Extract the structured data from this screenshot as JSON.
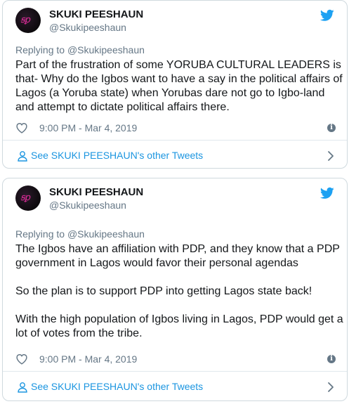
{
  "colors": {
    "twitter_blue": "#1da1f2",
    "link_blue": "#1b95e0",
    "secondary_text": "#657786",
    "avatar_accent": "#e02c9a"
  },
  "tweets": [
    {
      "author": {
        "display_name": "SKUKI PEESHAUN",
        "handle": "@Skukipeeshaun",
        "avatar_icon": "avatar-logo"
      },
      "replying_to": {
        "prefix": "Replying to",
        "handle": "@Skukipeeshaun"
      },
      "paragraphs": [
        "Part of the frustration of some YORUBA CULTURAL LEADERS is that- Why do the Igbos want to have a say in the political affairs of Lagos (a Yoruba state) when Yorubas dare not go to Igbo-land and attempt to dictate political affairs there."
      ],
      "timestamp": "9:00 PM - Mar 4, 2019",
      "other_tweets_label": "See SKUKI PEESHAUN's other Tweets"
    },
    {
      "author": {
        "display_name": "SKUKI PEESHAUN",
        "handle": "@Skukipeeshaun",
        "avatar_icon": "avatar-logo"
      },
      "replying_to": {
        "prefix": "Replying to",
        "handle": "@Skukipeeshaun"
      },
      "paragraphs": [
        "The Igbos have an affiliation with PDP, and they know that a PDP government in Lagos would favor their personal agendas",
        "So the plan is to support PDP into getting Lagos state back!",
        "With the high population of Igbos living  in Lagos, PDP would get a lot of votes from the tribe."
      ],
      "timestamp": "9:00 PM - Mar 4, 2019",
      "other_tweets_label": "See SKUKI PEESHAUN's other Tweets"
    }
  ]
}
